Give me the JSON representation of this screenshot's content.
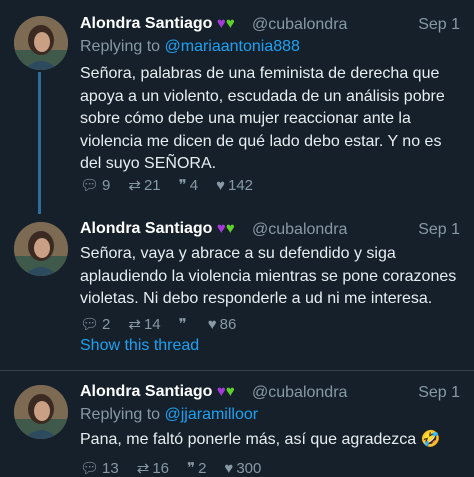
{
  "tweets": [
    {
      "name": "Alondra Santiago",
      "handle": "@cubalondra",
      "date": "Sep 1",
      "replying_prefix": "Replying to ",
      "replying_to": "@mariaantonia888",
      "text": "Señora, palabras de una feminista de derecha que apoya a un violento, escudada de un análisis pobre sobre cómo debe una mujer reaccionar ante la violencia me dicen de qué lado debo estar. Y no es del suyo SEÑORA.",
      "replies": "9",
      "retweets": "21",
      "quotes": "4",
      "likes": "142"
    },
    {
      "name": "Alondra Santiago",
      "handle": "@cubalondra",
      "date": "Sep 1",
      "text": "Señora, vaya y abrace a su defendido y siga aplaudiendo la violencia mientras se pone corazones violetas. Ni debo responderle a ud ni me interesa.",
      "replies": "2",
      "retweets": "14",
      "quotes": "",
      "likes": "86",
      "show_thread": "Show this thread"
    },
    {
      "name": "Alondra Santiago",
      "handle": "@cubalondra",
      "date": "Sep 1",
      "replying_prefix": "Replying to ",
      "replying_to": "@jjaramilloor",
      "text": "Pana, me faltó ponerle más, así que agradezca 🤣",
      "replies": "13",
      "retweets": "16",
      "quotes": "2",
      "likes": "300"
    }
  ],
  "icons": {
    "reply": "reply-icon",
    "retweet": "retweet-icon",
    "quote": "quote-icon",
    "like": "heart-icon",
    "name_hearts": [
      "purple-heart-icon",
      "green-heart-icon"
    ]
  },
  "colors": {
    "background": "#15202b",
    "link": "#1da1f2",
    "muted": "#8899a6",
    "thread_line": "#2f6c9a"
  }
}
